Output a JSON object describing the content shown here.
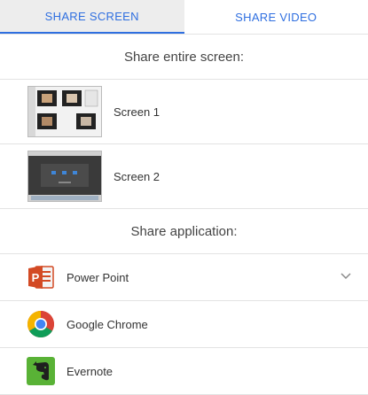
{
  "tabs": {
    "share_screen": "SHARE SCREEN",
    "share_video": "SHARE VIDEO"
  },
  "screens": {
    "title": "Share entire screen:",
    "items": [
      {
        "label": "Screen 1"
      },
      {
        "label": "Screen 2"
      }
    ]
  },
  "apps": {
    "title": "Share application:",
    "items": [
      {
        "label": "Power Point",
        "icon": "powerpoint-icon"
      },
      {
        "label": "Google Chrome",
        "icon": "chrome-icon"
      },
      {
        "label": "Evernote",
        "icon": "evernote-icon"
      }
    ]
  },
  "colors": {
    "accent": "#2f6fe0",
    "active_tab_bg": "#ededed",
    "divider": "#e3e3e3"
  }
}
